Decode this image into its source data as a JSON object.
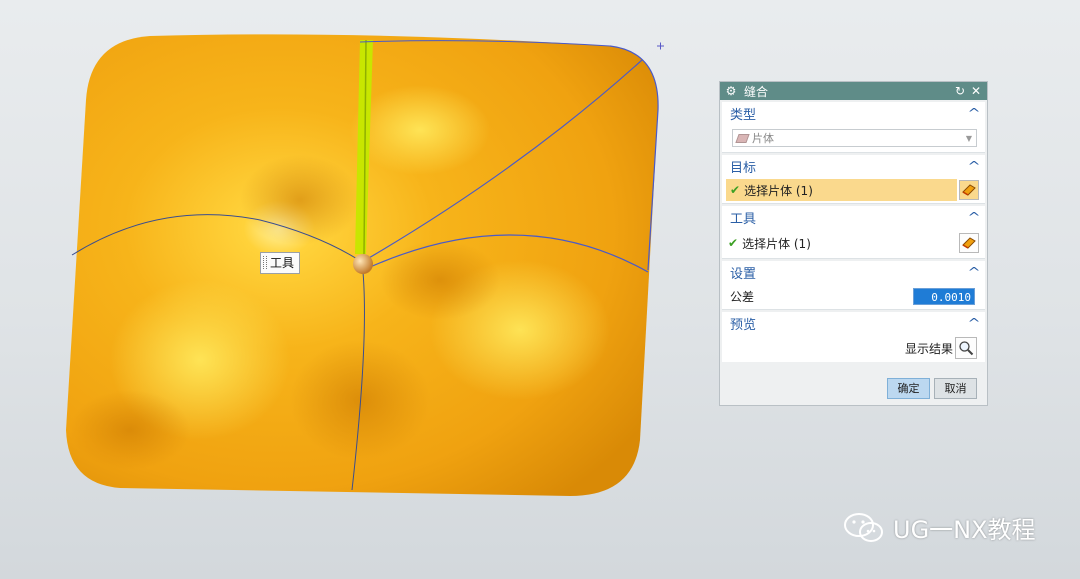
{
  "viewport": {
    "tooltip_label": "工具",
    "surface_color": "#f6b019",
    "highlight_edge_color": "#c8e600",
    "curve_color": "#4a5ac8"
  },
  "dialog": {
    "title": "缝合",
    "title_icon": "gear-icon",
    "reset_icon": "reset-icon",
    "close_icon": "close-icon",
    "sections": {
      "type": {
        "header": "类型",
        "dropdown_value": "片体"
      },
      "target": {
        "header": "目标",
        "selection_label": "选择片体 (1)"
      },
      "tool": {
        "header": "工具",
        "selection_label": "选择片体 (1)"
      },
      "settings": {
        "header": "设置",
        "tolerance_label": "公差",
        "tolerance_value": "0.0010"
      },
      "preview": {
        "header": "预览",
        "show_result_label": "显示结果"
      }
    },
    "buttons": {
      "ok": "确定",
      "cancel": "取消"
    },
    "accent_color": "#5f8c88",
    "highlight_color": "#fad98d"
  },
  "watermark": {
    "text": "UG一NX教程"
  }
}
